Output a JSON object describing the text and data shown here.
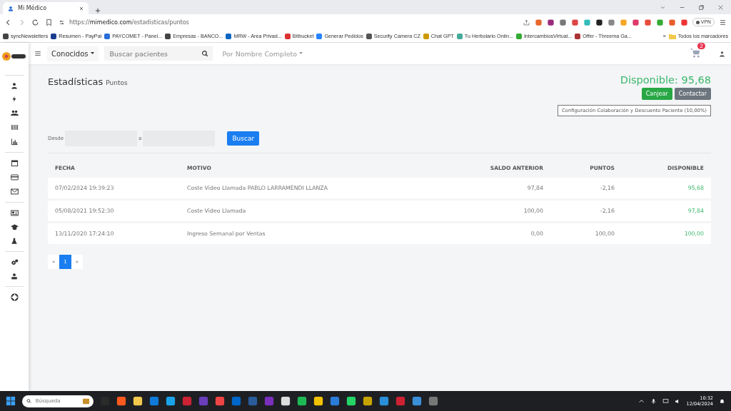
{
  "browser": {
    "tab_title": "Mi Médico",
    "url_host": "https://mimedico.com",
    "url_path": "/estadisticas/puntos",
    "vpn": "VPN",
    "bookmarks": [
      "syncNewsletters",
      "Resumen - PayPal",
      "PAYCOMET - Panel...",
      "Empresas - BANCO...",
      "MRW - Area Privad...",
      "Bitbucket",
      "Generar Pedidos",
      "Security Camera CZ",
      "Chat GPT",
      "Tu Herbolario Onlin...",
      "IntercambiosVirtual...",
      "Offer - Threema Ga..."
    ],
    "bookmarks_more": "»",
    "all_bookmarks": "Todos los marcadores"
  },
  "header": {
    "filter": "Conocidos",
    "search_placeholder": "Buscar pacientes",
    "sort": "Por Nombre Completo",
    "cart_count": "2"
  },
  "page": {
    "title": "Estadísticas",
    "subtitle": "Puntos",
    "available": "Disponible: 95,68",
    "redeem": "Canjear",
    "contact": "Contactar",
    "config": "Configuración Colaboración y Descuento Paciente (10,00%)",
    "from_label": "Desde",
    "to_label": "a",
    "search_button": "Buscar"
  },
  "table": {
    "columns": [
      "FECHA",
      "MOTIVO",
      "SALDO ANTERIOR",
      "PUNTOS",
      "DISPONIBLE"
    ],
    "rows": [
      {
        "fecha": "07/02/2024 19:39:23",
        "motivo": "Coste Video Llamada PABLO LARRAMENDI LLANZA",
        "saldo": "97,84",
        "puntos": "-2,16",
        "disponible": "95,68"
      },
      {
        "fecha": "05/08/2021 19:52:30",
        "motivo": "Coste Video Llamada",
        "saldo": "100,00",
        "puntos": "-2,16",
        "disponible": "97,84"
      },
      {
        "fecha": "13/11/2020 17:24:10",
        "motivo": "Ingreso Semanal por Ventas",
        "saldo": "0,00",
        "puntos": "100,00",
        "disponible": "100,00"
      }
    ]
  },
  "pagination": {
    "prev": "«",
    "pages": [
      {
        "label": "1",
        "selected": true
      }
    ],
    "next": "»"
  },
  "taskbar": {
    "search_placeholder": "Búsqueda",
    "time": "10:32",
    "date": "12/04/2024"
  }
}
